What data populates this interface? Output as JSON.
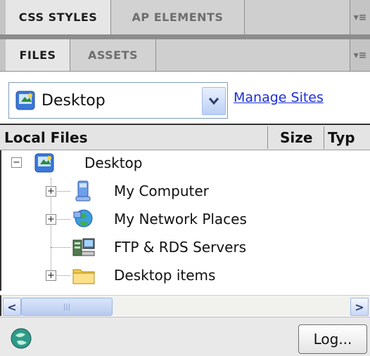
{
  "panel_tabs_top": [
    "CSS STYLES",
    "AP ELEMENTS"
  ],
  "panel_tabs_files": [
    "FILES",
    "ASSETS"
  ],
  "panel_menu_glyph": "▾≡",
  "site_selector": {
    "value": "Desktop",
    "icon": "desktop-icon"
  },
  "manage_sites_label": "Manage Sites",
  "columns": {
    "local_files": "Local Files",
    "size": "Size",
    "type": "Typ"
  },
  "tree": {
    "root": "Desktop",
    "root_toggle": "−",
    "items": [
      {
        "label": "My Computer",
        "icon": "computer-icon",
        "toggle": "+"
      },
      {
        "label": "My Network Places",
        "icon": "network-places-icon",
        "toggle": "+"
      },
      {
        "label": "FTP & RDS Servers",
        "icon": "ftp-server-icon",
        "toggle": ""
      },
      {
        "label": "Desktop items",
        "icon": "folder-icon",
        "toggle": "+"
      }
    ]
  },
  "scroll": {
    "left": "<",
    "right": ">",
    "thumb": "|||"
  },
  "log_button": "Log...",
  "colors": {
    "accent": "#1b2fd6",
    "tab_bg": "#c4c4c4"
  }
}
